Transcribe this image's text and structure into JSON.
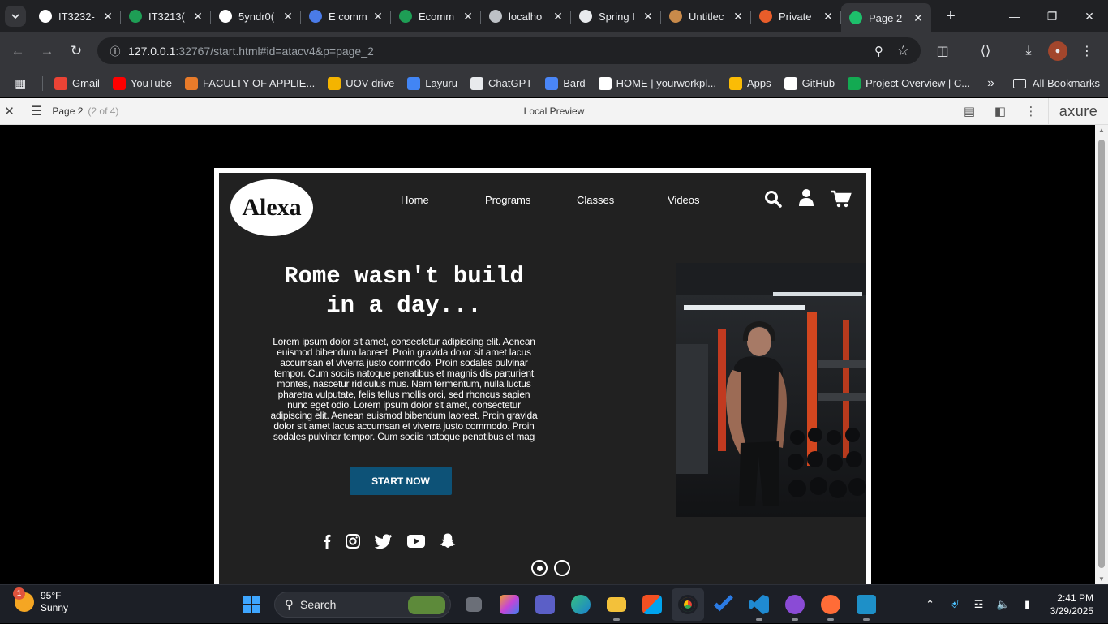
{
  "browser": {
    "tabs": [
      {
        "title": "IT3232-",
        "icon": "github-icon",
        "color": "#ffffff"
      },
      {
        "title": "IT3213(",
        "icon": "sheets-icon",
        "color": "#1e9e55"
      },
      {
        "title": "5yndr0(",
        "icon": "github-icon",
        "color": "#ffffff"
      },
      {
        "title": "E comm",
        "icon": "slides-icon",
        "color": "#4a7be8"
      },
      {
        "title": "Ecomm",
        "icon": "sheets-icon",
        "color": "#1e9e55"
      },
      {
        "title": "localho",
        "icon": "globe-icon",
        "color": "#bdc1c6"
      },
      {
        "title": "Spring I",
        "icon": "chatgpt-icon",
        "color": "#e8eaed"
      },
      {
        "title": "Untitlec",
        "icon": "cat-icon",
        "color": "#c88a4a"
      },
      {
        "title": "Private",
        "icon": "medium-icon",
        "color": "#e85d2a"
      },
      {
        "title": "Page 2",
        "icon": "axure-play-icon",
        "color": "#1dbf6b",
        "active": true
      }
    ],
    "url_host": "127.0.0.1",
    "url_rest": ":32767/start.html#id=atacv4&p=page_2",
    "bookmarks": [
      {
        "label": "Gmail",
        "icon": "gmail-icon",
        "color": "#ea4335"
      },
      {
        "label": "YouTube",
        "icon": "youtube-icon",
        "color": "#ff0000"
      },
      {
        "label": "FACULTY OF APPLIE...",
        "icon": "faculty-icon",
        "color": "#e87b2a"
      },
      {
        "label": "UOV drive",
        "icon": "drive-icon",
        "color": "#f4b400"
      },
      {
        "label": "Layuru",
        "icon": "drive-icon",
        "color": "#4285f4"
      },
      {
        "label": "ChatGPT",
        "icon": "chatgpt-icon",
        "color": "#e8eaed"
      },
      {
        "label": "Bard",
        "icon": "bard-icon",
        "color": "#4a86f7"
      },
      {
        "label": "HOME | yourworkpl...",
        "icon": "wix-icon",
        "color": "#ffffff"
      },
      {
        "label": "Apps",
        "icon": "apps-grid-icon",
        "color": "#fbbc05"
      },
      {
        "label": "GitHub",
        "icon": "github-icon",
        "color": "#ffffff"
      },
      {
        "label": "Project Overview | C...",
        "icon": "leaf-icon",
        "color": "#13aa52"
      }
    ],
    "all_bookmarks": "All Bookmarks"
  },
  "axure": {
    "page_name": "Page 2",
    "page_count": "(2 of 4)",
    "preview_label": "Local Preview",
    "brand": "axure"
  },
  "site": {
    "logo": "Alexa",
    "nav": [
      "Home",
      "Programs",
      "Classes",
      "Videos"
    ],
    "hero_title_line1": "Rome wasn't build",
    "hero_title_line2": "in a day...",
    "hero_text": "Lorem ipsum dolor sit amet, consectetur adipiscing elit. Aenean euismod bibendum laoreet. Proin gravida dolor sit amet lacus accumsan et viverra justo commodo. Proin sodales pulvinar tempor. Cum sociis natoque penatibus et magnis dis parturient montes, nascetur ridiculus mus. Nam fermentum, nulla luctus pharetra vulputate, felis tellus mollis orci, sed rhoncus sapien nunc eget odio. Lorem ipsum dolor sit amet, consectetur adipiscing elit. Aenean euismod bibendum laoreet. Proin gravida dolor sit amet lacus accumsan et viverra justo commodo. Proin sodales pulvinar tempor. Cum sociis natoque penatibus et mag",
    "cta": "START NOW",
    "accent": "#0d5277",
    "slides_total": 2,
    "slide_active": 1
  },
  "taskbar": {
    "weather_temp": "95°F",
    "weather_desc": "Sunny",
    "weather_badge": "1",
    "search_placeholder": "Search",
    "time": "2:41 PM",
    "date": "3/29/2025"
  }
}
